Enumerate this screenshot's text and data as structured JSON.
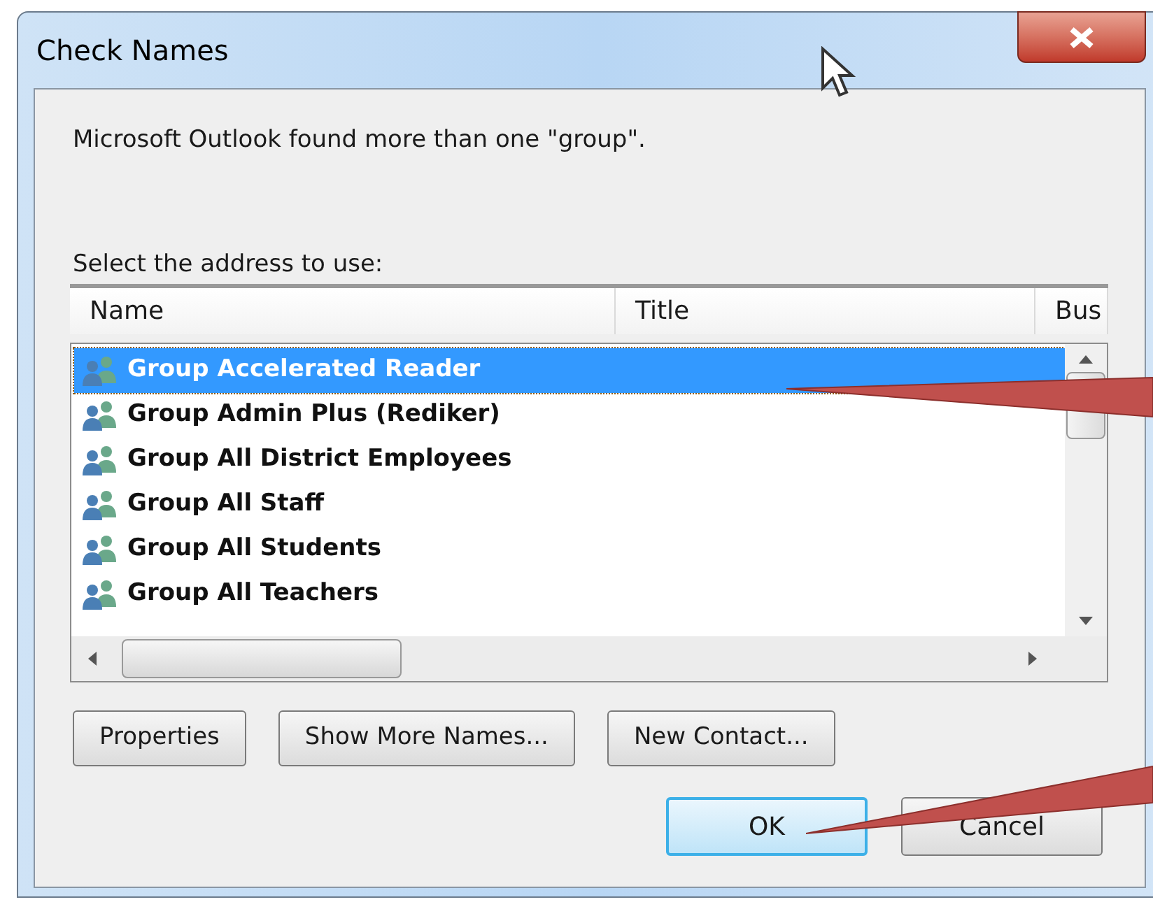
{
  "window": {
    "title": "Check Names"
  },
  "message": "Microsoft Outlook found more than one \"group\".",
  "prompt": "Select the address to use:",
  "table": {
    "columns": [
      "Name",
      "Title",
      "Bus"
    ],
    "rows": [
      {
        "name": "Group Accelerated Reader",
        "selected": true
      },
      {
        "name": "Group Admin Plus (Rediker)",
        "selected": false
      },
      {
        "name": "Group All District Employees",
        "selected": false
      },
      {
        "name": "Group All Staff",
        "selected": false
      },
      {
        "name": "Group All Students",
        "selected": false
      },
      {
        "name": "Group All Teachers",
        "selected": false
      }
    ]
  },
  "action_buttons": [
    "Properties",
    "Show More Names...",
    "New Contact..."
  ],
  "dialog_buttons": [
    {
      "label": "OK",
      "default": true
    },
    {
      "label": "Cancel",
      "default": false
    }
  ]
}
